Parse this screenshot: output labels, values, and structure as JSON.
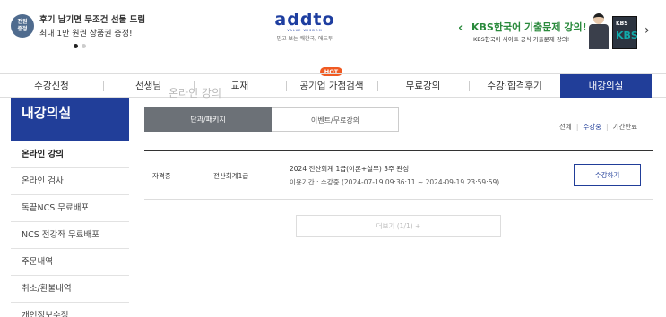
{
  "banner": {
    "badge": "전원\n증정",
    "line1": "후기 남기면 무조건 선물 드림",
    "line2": "최대 1만 원권 상품권 증정!",
    "logo": "addto",
    "logo_sub1": "VALUE WISDOM",
    "logo_sub2": "믿고 보는 쾌한국, 애드투",
    "right_title": "KBS한국어 기출문제 강의!",
    "right_sub": "KBS한국어 사이트 공식 기출문제 강의!",
    "book_label1": "KBS",
    "book_label2": "KBS"
  },
  "nav": {
    "items": [
      "수강신청",
      "선생님",
      "교재",
      "공기업 가점검색",
      "무료강의",
      "수강·합격후기",
      "내강의실"
    ],
    "hot_badge": "HOT"
  },
  "sidebar": {
    "title": "내강의실",
    "items": [
      "온라인 강의",
      "온라인 검사",
      "독끝NCS 무료배포",
      "NCS 전강좌 무료배포",
      "주문내역",
      "취소/환불내역",
      "개인정보수정"
    ]
  },
  "main": {
    "ghost_heading": "온라인 강의",
    "tabs": [
      "단과/패키지",
      "이벤트/무료강의"
    ],
    "filters": [
      "전체",
      "수강중",
      "기간만료"
    ],
    "course": {
      "category": "자격증",
      "subject": "전산회계1급",
      "title": "2024 전산회계 1급(이론+실무) 3주 완성",
      "period": "이용기간 : 수강중 (2024-07-19 09:36:11 ~ 2024-09-19 23:59:59)",
      "button": "수강하기"
    },
    "more": "더보기 (1/1) +"
  },
  "colors": {
    "primary": "#213e99",
    "green": "#2a8a3c",
    "hot": "#f05a22",
    "tab_active": "#6c7177"
  }
}
